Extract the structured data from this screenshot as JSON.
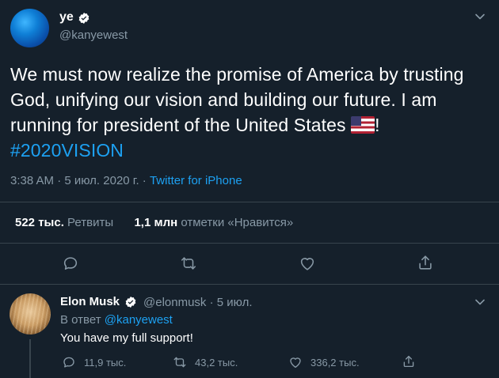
{
  "tweet": {
    "author_name": "ye",
    "author_handle": "@kanyewest",
    "text_main": "We must now realize the promise of America by trusting God, unifying our vision and building our future. I am running for president of the United States ",
    "text_after_flag": "! ",
    "hashtag": "#2020VISION",
    "timestamp": "3:38 AM · 5 июл. 2020 г. · ",
    "source": "Twitter for iPhone",
    "retweets_count": "522 тыс.",
    "retweets_label": "Ретвиты",
    "likes_count": "1,1 млн",
    "likes_label": "отметки «Нравится»"
  },
  "reply": {
    "author_name": "Elon Musk",
    "author_handle": "@elonmusk · 5 июл.",
    "reply_to_prefix": "В ответ ",
    "reply_to_handle": "@kanyewest",
    "text": "You have my full support!",
    "replies": "11,9 тыс.",
    "retweets": "43,2 тыс.",
    "likes": "336,2 тыс."
  },
  "colors": {
    "background": "#15202b",
    "accent": "#1da1f2",
    "muted": "#8899a6",
    "divider": "#38444d"
  },
  "icons": [
    "verified-badge-icon",
    "chevron-down-icon",
    "reply-icon",
    "retweet-icon",
    "heart-icon",
    "share-icon",
    "us-flag-emoji"
  ]
}
